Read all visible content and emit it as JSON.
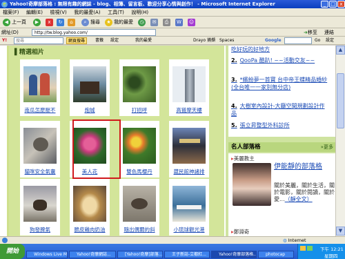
{
  "window": {
    "title": "Yahoo!奇摩部落格 : 無限有趣的網誌 - blog、相簿、留言板、歡迎分享心情與創作！ - Microsoft Internet Explorer"
  },
  "menu": [
    "檔案(F)",
    "編輯(E)",
    "檢視(V)",
    "我的最愛(A)",
    "工具(T)",
    "說明(H)"
  ],
  "toolbar": {
    "back": "上一頁",
    "search": "搜尋",
    "favorites": "我的最愛"
  },
  "address": {
    "label": "網址(D)",
    "url": "http://tw.blog.yahoo.com/",
    "go": "移至",
    "links": "連結"
  },
  "links": {
    "yahoo_search_placeholder": "搜尋",
    "web_search": "網頁搜尋",
    "bookmarks": "書籤",
    "settings": "設定",
    "drayo": "Drayo",
    "capture": "捕擷",
    "practical": "實用",
    "favorites": "我的最愛",
    "spaces": "Spaces",
    "google": "Google",
    "go": "Go",
    "settings2": "設定"
  },
  "album": {
    "heading": "精選相片",
    "photos": [
      {
        "caption": "南瓜怎麼壓不"
      },
      {
        "caption": "炮城"
      },
      {
        "caption": "打招呼"
      },
      {
        "caption": "高聳摩天樓"
      },
      {
        "caption": "貓咪安全氣囊"
      },
      {
        "caption": "美人花"
      },
      {
        "caption": "雙色馬櫻丹"
      },
      {
        "caption": "葳民館神諸排"
      },
      {
        "caption": "狗發脾氣"
      },
      {
        "caption": "脆皮雞肉奶油"
      },
      {
        "caption": "隨出偶爾的斜"
      },
      {
        "caption": "小琉球觀光港"
      }
    ]
  },
  "news": {
    "top_partial": "吃好玩的好地方",
    "items": [
      {
        "num": "2.",
        "text": "QooPa 酷趴! ~~活動交友~~"
      },
      {
        "num": "3.",
        "text": "*繽紛夢一首寶 台中帝王蝶精品婚紗(全台唯一一家別無分店)"
      },
      {
        "num": "4.",
        "text": "大樹室內設計-大廳空間規劃設計作品"
      },
      {
        "num": "5.",
        "text": "張立昇整型外科診所"
      }
    ]
  },
  "blogs": {
    "heading": "名人部落格",
    "more": "更多",
    "featured_tag": "美麗教主",
    "featured_title": "伊能靜的部落格",
    "featured_desc": "關於美麗，關於生活，關於電影，關於閱讀，關於愛...",
    "featured_link": "（靜全文）",
    "next_tag": "鄭淵奇"
  },
  "status": {
    "zone": "Internet"
  },
  "taskbar": {
    "start": "開始",
    "tasks": [
      "Windows Live Mess...",
      "Yahoo!奇摩網誌...",
      "[Yahoo!奇摩]部落...",
      "王子新誌-立都紅...",
      "Yahoo!奇摩部落格...",
      "photocap"
    ],
    "clock_label": "下午 12:21",
    "day": "星期四"
  }
}
